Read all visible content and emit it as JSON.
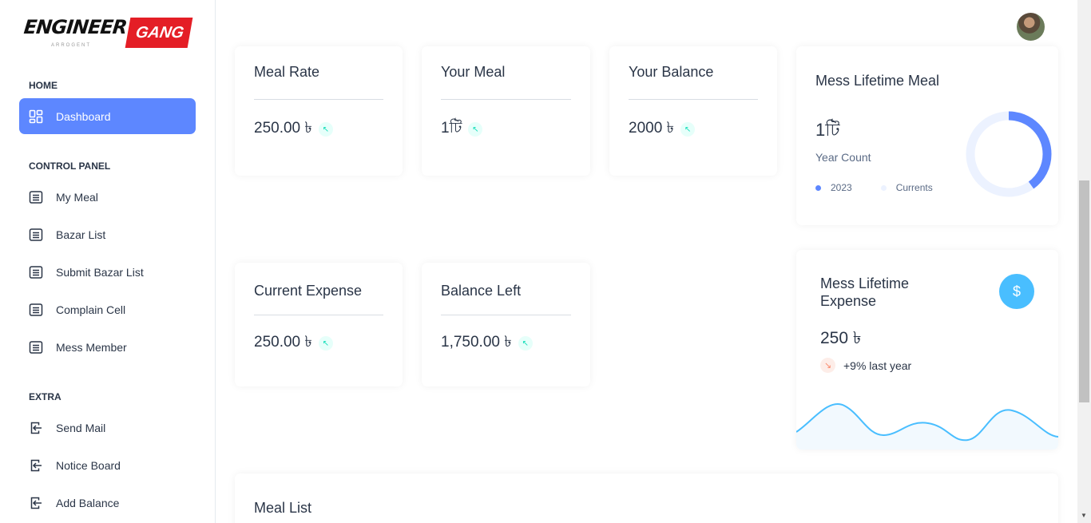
{
  "logo": {
    "word1": "ENGINEER",
    "word2": "GANG",
    "sub": "ARROGENT"
  },
  "sidebar": {
    "sections": [
      {
        "label": "HOME"
      },
      {
        "label": "CONTROL PANEL"
      },
      {
        "label": "EXTRA"
      }
    ],
    "items": [
      {
        "label": "Dashboard",
        "icon": "dashboard-icon",
        "active": true
      },
      {
        "label": "My Meal",
        "icon": "list-icon"
      },
      {
        "label": "Bazar List",
        "icon": "list-icon"
      },
      {
        "label": "Submit Bazar List",
        "icon": "list-icon"
      },
      {
        "label": "Complain Cell",
        "icon": "list-icon"
      },
      {
        "label": "Mess Member",
        "icon": "list-icon"
      },
      {
        "label": "Send Mail",
        "icon": "login-icon"
      },
      {
        "label": "Notice Board",
        "icon": "login-icon"
      },
      {
        "label": "Add Balance",
        "icon": "login-icon"
      }
    ]
  },
  "cards": {
    "meal_rate": {
      "title": "Meal Rate",
      "value": "250.00 ৳"
    },
    "your_meal": {
      "title": "Your Meal",
      "value": "1টি"
    },
    "your_balance": {
      "title": "Your Balance",
      "value": "2000 ৳"
    },
    "current_expense": {
      "title": "Current Expense",
      "value": "250.00 ৳"
    },
    "balance_left": {
      "title": "Balance Left",
      "value": "1,750.00 ৳"
    }
  },
  "lifetime_meal": {
    "title": "Mess Lifetime Meal",
    "value": "1টি",
    "subtitle": "Year Count",
    "legend": [
      {
        "label": "2023",
        "color": "#5d87ff"
      },
      {
        "label": "Currents",
        "color": "#ecf2ff"
      }
    ],
    "donut_fraction": 0.4
  },
  "lifetime_expense": {
    "title_line1": "Mess Lifetime",
    "title_line2": "Expense",
    "value": "250 ৳",
    "change": "+9% last year",
    "icon": "dollar-icon"
  },
  "meal_list": {
    "title": "Meal List"
  },
  "colors": {
    "primary": "#5d87ff",
    "secondary": "#49beff",
    "success": "#13deb9",
    "danger": "#fa896b"
  }
}
